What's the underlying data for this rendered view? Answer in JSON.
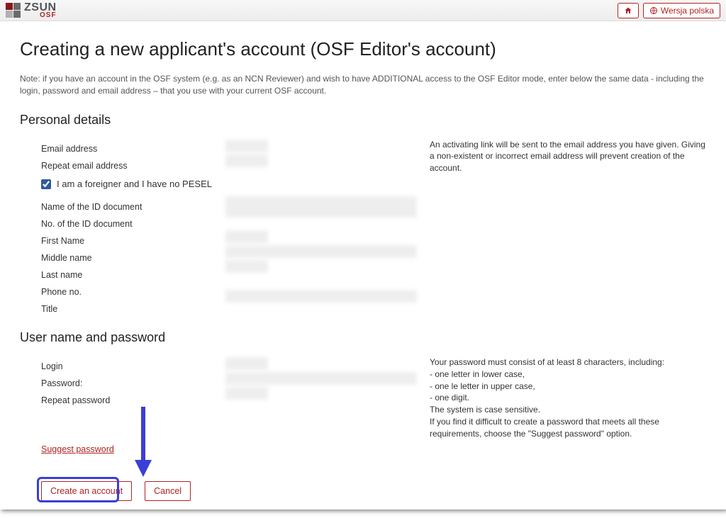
{
  "header": {
    "brand_main": "ZSUN",
    "brand_sub": "OSF",
    "home_label": "Home",
    "lang_label": "Wersja polska"
  },
  "page": {
    "title": "Creating a new applicant's account (OSF Editor's account)",
    "note": "Note: if you have an account in the OSF system (e.g. as an NCN Reviewer) and wish to have ADDITIONAL access to the OSF Editor mode, enter below the same data - including the login, password and email address – that you use with your current OSF account."
  },
  "sections": {
    "personal": {
      "heading": "Personal details",
      "labels": {
        "email": "Email address",
        "repeat_email": "Repeat email address",
        "foreigner": "I am a foreigner and I have no PESEL",
        "id_doc_name": "Name of the ID document",
        "id_doc_no": "No. of the ID document",
        "first_name": "First Name",
        "middle_name": "Middle name",
        "last_name": "Last name",
        "phone": "Phone no.",
        "title": "Title"
      },
      "help": "An activating link will be sent to the email address you have given. Giving a non-existent or incorrect email address will prevent creation of the account.",
      "foreigner_checked": true
    },
    "credentials": {
      "heading": "User name and password",
      "labels": {
        "login": "Login",
        "password": "Password:",
        "repeat_password": "Repeat password"
      },
      "suggest": "Suggest password",
      "help_lines": [
        "Your password must consist of at least 8 characters, including:",
        "- one letter in lower case,",
        "- one le letter in upper case,",
        "- one digit.",
        "The system is case sensitive.",
        "If you find it difficult to create a password that meets all these requirements, choose the \"Suggest password\" option."
      ]
    }
  },
  "actions": {
    "create": "Create an account",
    "cancel": "Cancel"
  }
}
